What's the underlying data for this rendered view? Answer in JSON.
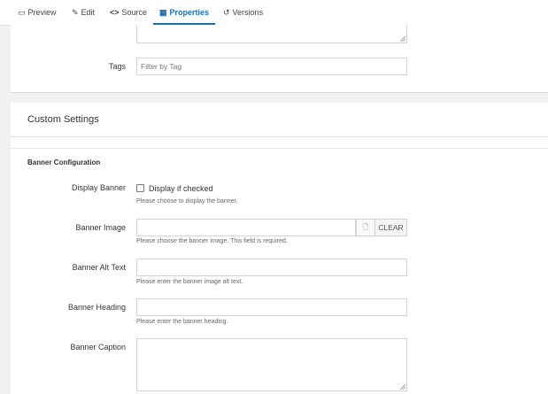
{
  "tabs": [
    {
      "label": "Preview",
      "icon": "monitor-icon"
    },
    {
      "label": "Edit",
      "icon": "pencil-icon"
    },
    {
      "label": "Source",
      "icon": "code-icon"
    },
    {
      "label": "Properties",
      "icon": "properties-icon",
      "active": true
    },
    {
      "label": "Versions",
      "icon": "history-icon"
    }
  ],
  "tags": {
    "label": "Tags",
    "placeholder": "Filter by Tag"
  },
  "custom_settings": {
    "title": "Custom Settings",
    "section_title": "Banner Configuration",
    "display_banner": {
      "label": "Display Banner",
      "checkbox_label": "Display if checked",
      "help": "Please choose to display the banner.",
      "checked": false
    },
    "banner_image": {
      "label": "Banner Image",
      "value": "",
      "clear_label": "CLEAR",
      "help": "Please choose the banner image. This field is required."
    },
    "banner_alt_text": {
      "label": "Banner Alt Text",
      "value": "",
      "help": "Please enter the banner image alt text."
    },
    "banner_heading": {
      "label": "Banner Heading",
      "value": "",
      "help": "Please enter the banner heading."
    },
    "banner_caption": {
      "label": "Banner Caption",
      "value": ""
    }
  },
  "colors": {
    "accent": "#1a6fb0",
    "background": "#f1f1f1"
  }
}
